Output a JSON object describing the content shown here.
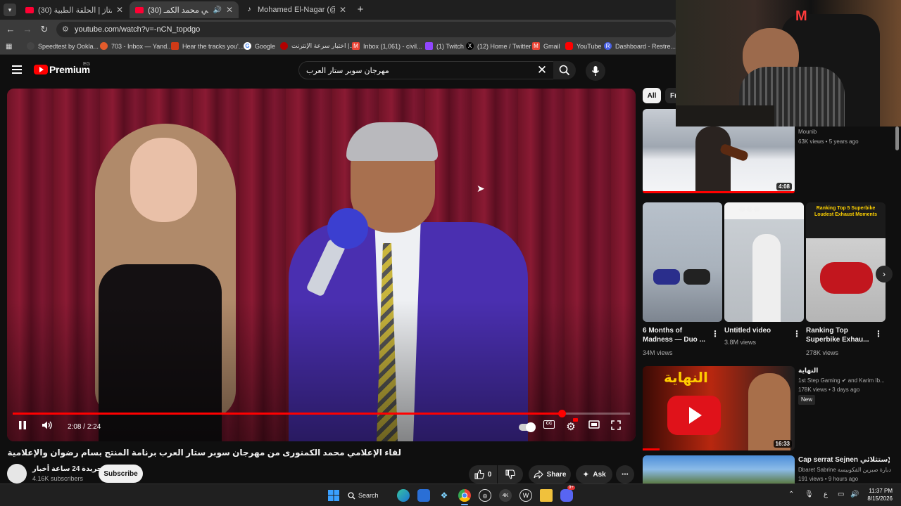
{
  "browser": {
    "tabs": [
      {
        "title": "(30) السيت المتاز | الحلقة الطبية",
        "type": "youtube",
        "active": false
      },
      {
        "title": "(30) لقاء الاعلامي محمد الكمـ",
        "type": "youtube",
        "active": true
      },
      {
        "title": "Mohamed El-Nagar (@nagaret)",
        "type": "tiktok",
        "active": false
      }
    ],
    "new_tab_label": "+",
    "url": "youtube.com/watch?v=-nCN_topdgo",
    "bookmarks": [
      {
        "label": "Speedtest by Ookla...",
        "color": "#444"
      },
      {
        "label": "703 - Inbox — Yand...",
        "color": "#e35b2b"
      },
      {
        "label": "Hear the tracks you'...",
        "color": "#d03a17"
      },
      {
        "label": "Google",
        "color": "#fff"
      },
      {
        "label": "اختبار سرعة الإنترنت |...",
        "color": "#b30000"
      },
      {
        "label": "Inbox (1,061) - civil...",
        "color": "#ea4335"
      },
      {
        "label": "(1) Twitch",
        "color": "#9146ff"
      },
      {
        "label": "(12) Home / Twitter",
        "color": "#000"
      },
      {
        "label": "Gmail",
        "color": "#ea4335"
      },
      {
        "label": "YouTube",
        "color": "#ff0000"
      },
      {
        "label": "Dashboard - Restre...",
        "color": "#4a62e8"
      }
    ]
  },
  "youtube": {
    "brand": "Premium",
    "country": "EG",
    "search_query": "مهرجان سوبر ستار العرب",
    "player": {
      "current_time": "2:08",
      "duration": "2:24",
      "progress_fraction": 0.889,
      "autoplay_on": true
    },
    "video": {
      "title": "لقاء الإعلامي محمد الكمنورى من مهرجان سوبر ستار العرب برنامة المنتج بسام رضوان والإعلامية دينا محمود",
      "channel_name": "جريدة 24 ساعة أخبار",
      "subscribers": "4.16K subscribers",
      "subscribe_label": "Subscribe",
      "likes": "0",
      "share_label": "Share",
      "ask_label": "Ask"
    },
    "chips": [
      "All",
      "Fr"
    ],
    "recommendations": [
      {
        "title": "",
        "channel": "Mounib",
        "meta": "63K views • 5 years ago",
        "duration": "4:08"
      },
      {
        "title": "النهاية",
        "channel": "1st Step Gaming ✔ and Karim Ib...",
        "meta": "178K views • 3 days ago",
        "badge": "New",
        "duration": "16:33",
        "thumb_text": "النهاية"
      },
      {
        "title": "Cap serrat Sejnen اليوم الإستثلائي",
        "channel": "Dbaret Sabrine دبارة صبرين الفكوبيسة",
        "meta": "191 views • 9 hours ago"
      }
    ],
    "shorts": [
      {
        "title": "6 Months of Madness — Duo ...",
        "views": "34M views"
      },
      {
        "title": "Untitled video",
        "views": "3.8M views",
        "thumb_text": "😂😂😂"
      },
      {
        "title": "Ranking Top Superbike Exhau...",
        "views": "278K views",
        "thumb_text": "Ranking Top 5 Superbike Loudest Exhaust Moments"
      }
    ]
  },
  "taskbar": {
    "search_label": "Search",
    "lang": "ع",
    "time": "11:37 PM",
    "date": "8/15/2026",
    "discord_badge": "9+"
  }
}
